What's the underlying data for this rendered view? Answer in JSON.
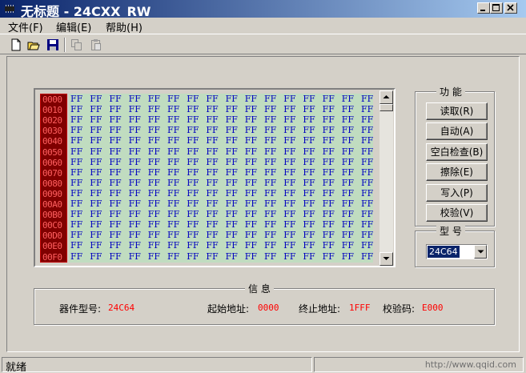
{
  "window": {
    "title": "无标题 - 24CXX_RW",
    "icons": [
      "app-icon",
      "minimize-icon",
      "maximize-icon",
      "close-icon"
    ]
  },
  "menu": [
    "文件(F)",
    "编辑(E)",
    "帮助(H)"
  ],
  "toolbar": {
    "icons": [
      "new-file-icon",
      "open-folder-icon",
      "save-icon",
      "copy-icon",
      "paste-icon"
    ]
  },
  "hex": {
    "addresses": [
      "0000",
      "0010",
      "0020",
      "0030",
      "0040",
      "0050",
      "0060",
      "0070",
      "0080",
      "0090",
      "00A0",
      "00B0",
      "00C0",
      "00D0",
      "00E0",
      "00F0"
    ],
    "bytes_per_row": 16,
    "fill_value": "FF",
    "address_color": "#ff6060",
    "address_bg": "#800000",
    "data_color": "#0000c0",
    "data_bg": "#c0dcc0"
  },
  "function_group": {
    "title": "功  能",
    "buttons": [
      "读取(R)",
      "自动(A)",
      "空白检查(B)",
      "擦除(E)",
      "写入(P)",
      "校验(V)"
    ]
  },
  "model_group": {
    "title": "型  号",
    "selected": "24C64"
  },
  "info_group": {
    "title": "信  息",
    "device_label": "器件型号:",
    "device_value": "24C64",
    "start_label": "起始地址:",
    "start_value": "0000",
    "end_label": "终止地址:",
    "end_value": "1FFF",
    "checksum_label": "校验码:",
    "checksum_value": "E000",
    "value_color": "#ff0000"
  },
  "status": {
    "text": "就绪",
    "url": "http://www.qqid.com"
  }
}
